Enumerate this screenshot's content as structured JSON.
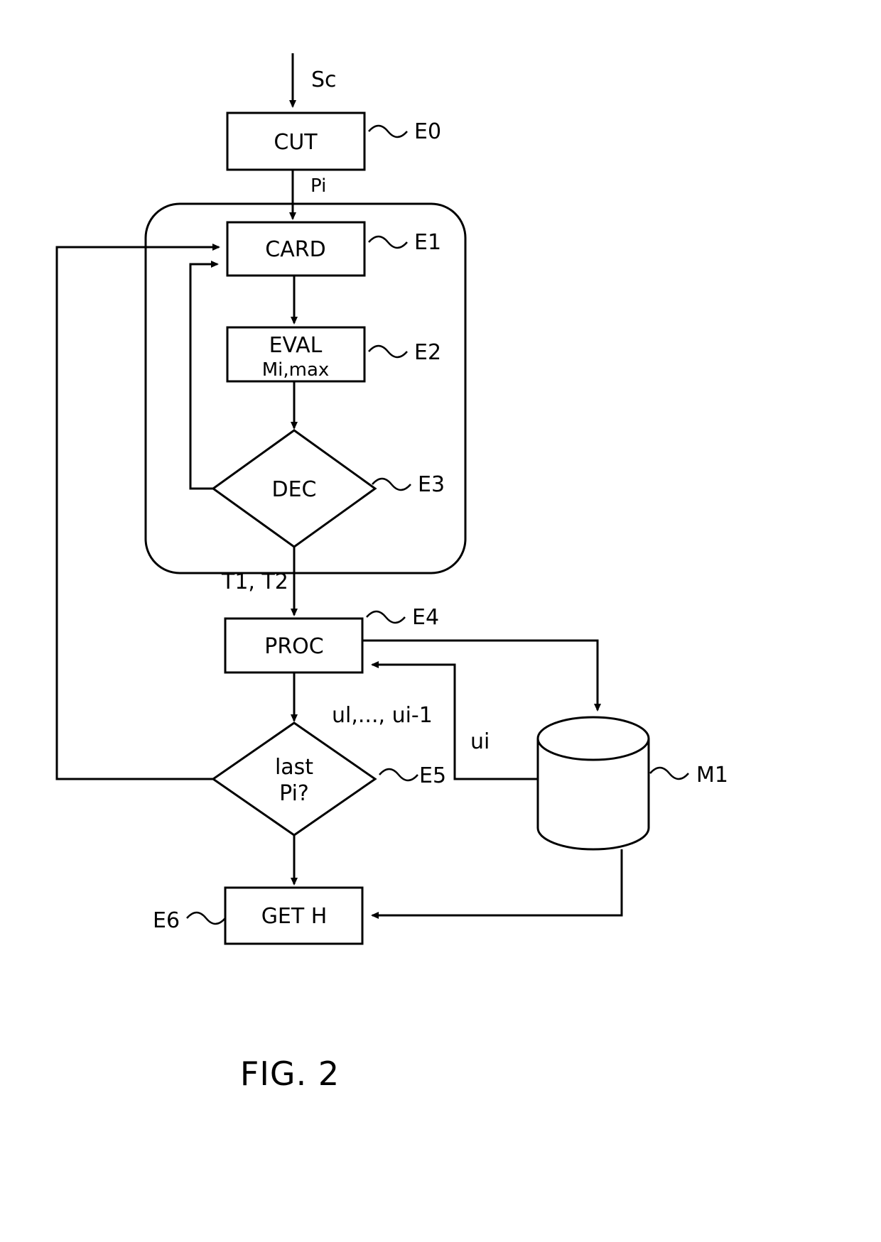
{
  "figure": {
    "caption": "FIG. 2"
  },
  "nodes": {
    "cut": {
      "label": "CUT",
      "ref": "E0"
    },
    "card": {
      "label": "CARD",
      "ref": "E1"
    },
    "eval": {
      "label": "EVAL",
      "sublabel": "Mi,max",
      "ref": "E2"
    },
    "dec": {
      "label": "DEC",
      "ref": "E3"
    },
    "proc": {
      "label": "PROC",
      "ref": "E4"
    },
    "last": {
      "label_line1": "last",
      "label_line2": "Pi?",
      "ref": "E5"
    },
    "get": {
      "label": "GET H",
      "ref": "E6"
    },
    "memory": {
      "ref": "M1"
    }
  },
  "edges": {
    "input_signal": "Sc",
    "cut_to_card": "Pi",
    "dec_to_proc": "T1, T2",
    "proc_outputs": "ul,..., ui-1",
    "memory_in": "ui"
  },
  "colors": {
    "stroke": "#000000",
    "background": "#ffffff"
  }
}
